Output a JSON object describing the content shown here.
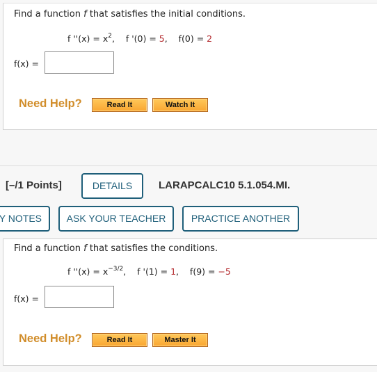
{
  "question1": {
    "prompt_pre": "Find a function ",
    "prompt_var": "f",
    "prompt_post": " that satisfies the initial conditions.",
    "eq1_lhs": "f ''(x) = x",
    "eq1_exp": "2",
    "eq1_tail": ",",
    "eq2_lhs": "f '(0) = ",
    "eq2_val": "5",
    "eq2_tail": ",",
    "eq3_lhs": "f(0) = ",
    "eq3_val": "2",
    "answer_label": "f(x) =",
    "answer_value": "",
    "need_help": "Need Help?",
    "help_buttons": [
      "Read It",
      "Watch It"
    ]
  },
  "question2_header": {
    "points": "[–/1 Points]",
    "details_button": "DETAILS",
    "question_id": "LARAPCALC10 5.1.054.MI.",
    "notes_button": "Y NOTES",
    "ask_teacher_button": "ASK YOUR TEACHER",
    "practice_another_button": "PRACTICE ANOTHER"
  },
  "question2": {
    "prompt_pre": "Find a function ",
    "prompt_var": "f",
    "prompt_post": " that satisfies the conditions.",
    "eq1_lhs": "f ''(x) = x",
    "eq1_exp": "−3/2",
    "eq1_tail": ",",
    "eq2_lhs": "f '(1) = ",
    "eq2_val": "1",
    "eq2_tail": ",",
    "eq3_lhs": "f(9) = ",
    "eq3_val": "−5",
    "answer_label": "f(x) =",
    "answer_value": "",
    "need_help": "Need Help?",
    "help_buttons": [
      "Read It",
      "Master It"
    ]
  },
  "colors": {
    "accent_orange": "#d18d2a",
    "button_orange": "#f9a631",
    "outline_blue": "#1f5f7a",
    "value_red": "#b3282c"
  }
}
